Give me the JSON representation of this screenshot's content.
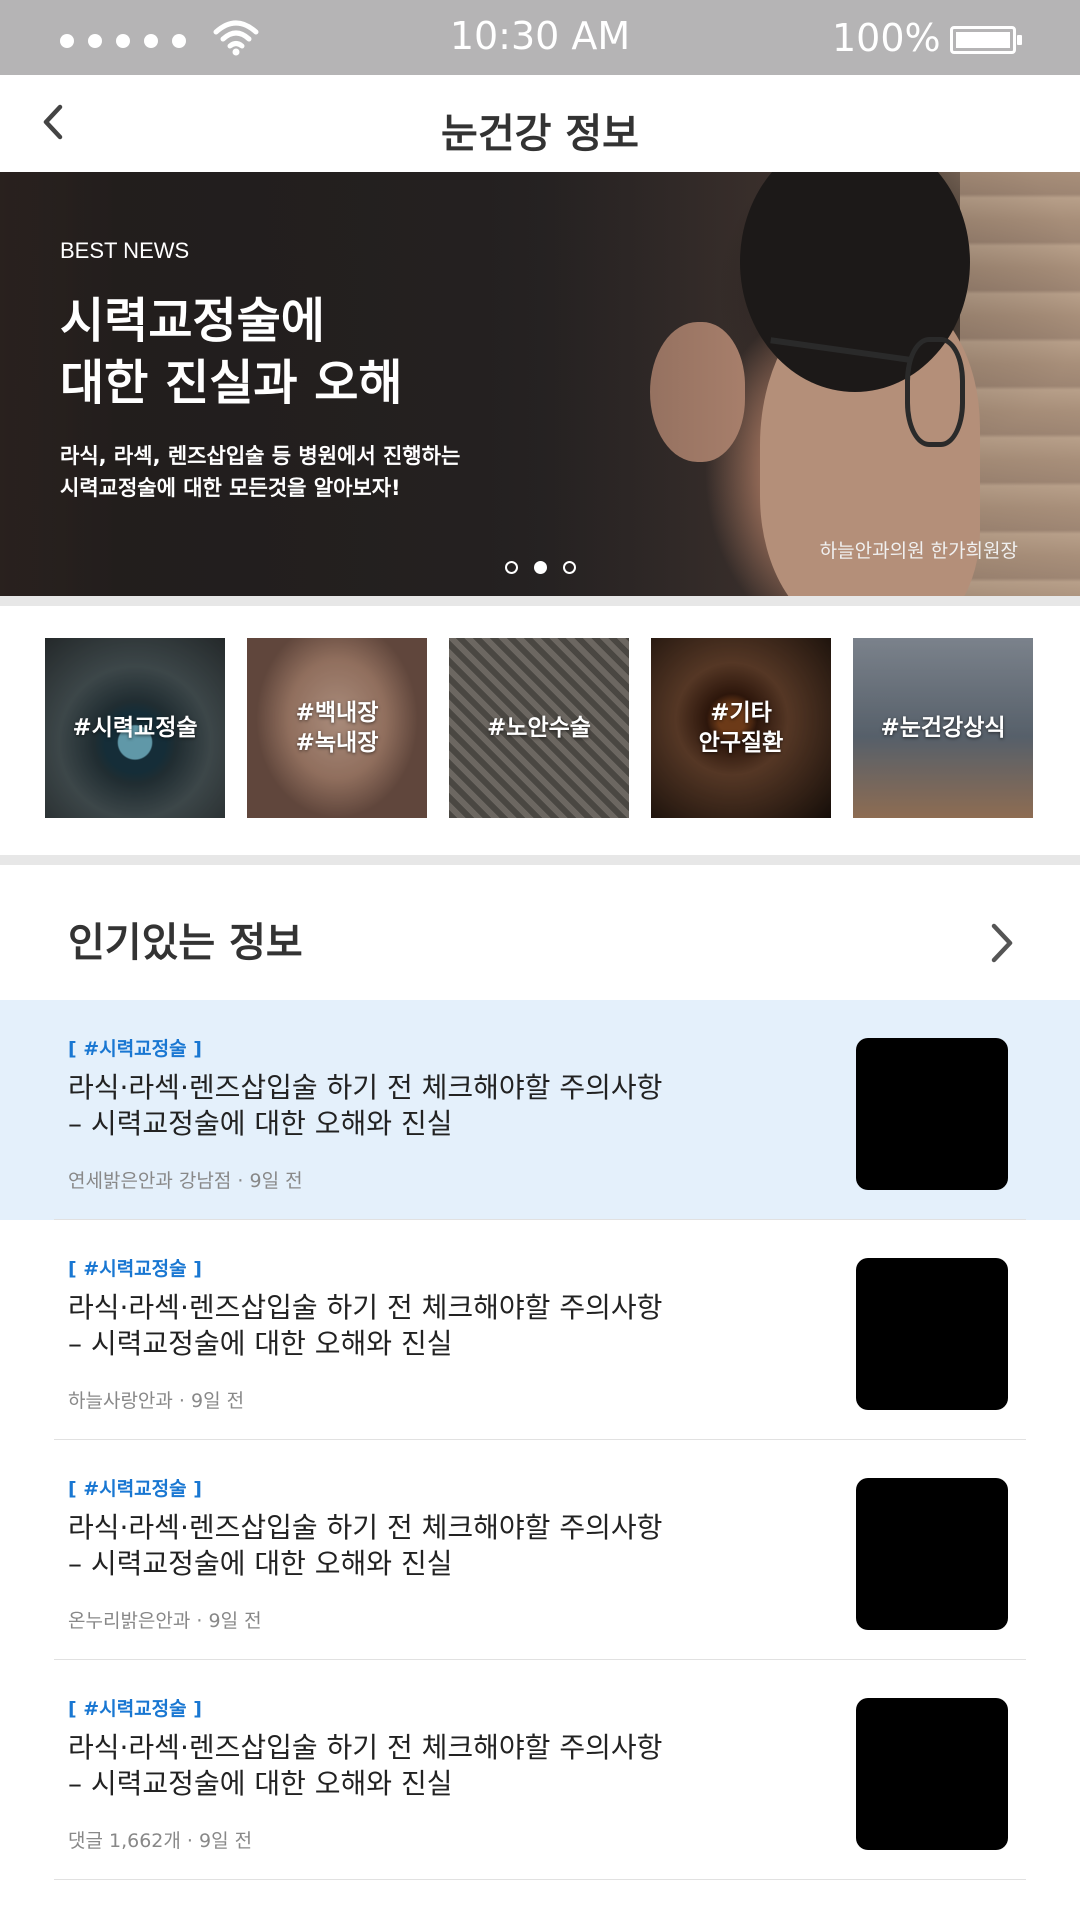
{
  "status_bar": {
    "time": "10:30 AM",
    "battery": "100%"
  },
  "header": {
    "title": "눈건강 정보"
  },
  "banner": {
    "eyebrow": "BEST NEWS",
    "title_lines": [
      "시력교정술에",
      "대한 진실과 오해"
    ],
    "desc_lines": [
      "라식, 라섹, 렌즈삽입술 등 병원에서 진행하는",
      "시력교정술에 대한 모든것을 알아보자!"
    ],
    "credit": "하늘안과의원 한가희원장",
    "slide_count": 3,
    "active_slide": 2
  },
  "categories": [
    {
      "lines": [
        "#시력교정술"
      ]
    },
    {
      "lines": [
        "#백내장",
        "#녹내장"
      ]
    },
    {
      "lines": [
        "#노안수술"
      ]
    },
    {
      "lines": [
        "#기타",
        "안구질환"
      ]
    },
    {
      "lines": [
        "#눈건강상식"
      ]
    }
  ],
  "popular": {
    "title": "인기있는 정보",
    "articles": [
      {
        "tag": "[ #시력교정술 ]",
        "headline": [
          "라식·라섹·렌즈삽입술 하기 전 체크해야할 주의사항",
          "– 시력교정술에 대한 오해와 진실"
        ],
        "meta": "연세밝은안과 강남점 · 9일 전",
        "highlighted": true
      },
      {
        "tag": "[ #시력교정술 ]",
        "headline": [
          "라식·라섹·렌즈삽입술 하기 전 체크해야할 주의사항",
          "– 시력교정술에 대한 오해와 진실"
        ],
        "meta": "하늘사랑안과 · 9일 전",
        "highlighted": false
      },
      {
        "tag": "[ #시력교정술 ]",
        "headline": [
          "라식·라섹·렌즈삽입술 하기 전 체크해야할 주의사항",
          "– 시력교정술에 대한 오해와 진실"
        ],
        "meta": "온누리밝은안과 · 9일 전",
        "highlighted": false
      },
      {
        "tag": "[ #시력교정술 ]",
        "headline": [
          "라식·라섹·렌즈삽입술 하기 전 체크해야할 주의사항",
          "– 시력교정술에 대한 오해와 진실"
        ],
        "meta": "댓글 1,662개 · 9일 전",
        "highlighted": false
      }
    ]
  },
  "colors": {
    "status_bar": "#b5b4b5",
    "tag_blue": "#1977d2",
    "highlight_row": "#e4f0fb"
  },
  "icons": {
    "back": "chevron-left-icon",
    "more": "chevron-right-icon",
    "wifi": "wifi-icon",
    "battery": "battery-icon"
  }
}
